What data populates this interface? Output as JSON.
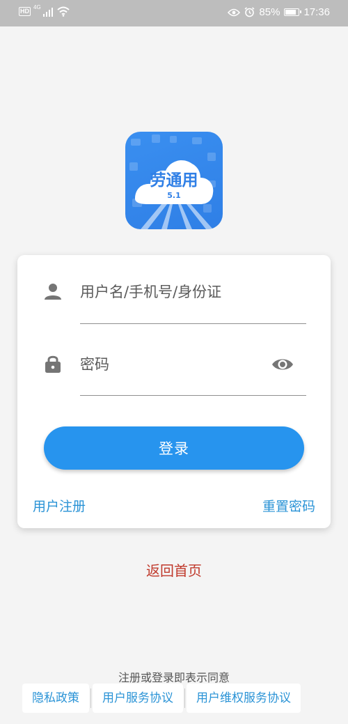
{
  "status_bar": {
    "hd": "HD",
    "network": "4G",
    "battery_percent": "85%",
    "battery_level": 0.85,
    "time": "17:36",
    "icons": [
      "signal-icon",
      "wifi-icon",
      "eye-comfort-icon",
      "alarm-icon",
      "battery-icon"
    ]
  },
  "logo": {
    "name": "劳通用",
    "version": "5.1"
  },
  "login": {
    "username_placeholder": "用户名/手机号/身份证",
    "password_placeholder": "密码",
    "login_label": "登录",
    "register_label": "用户注册",
    "reset_label": "重置密码"
  },
  "back_home_label": "返回首页",
  "agreement": {
    "text": "注册或登录即表示同意",
    "links": [
      "隐私政策",
      "用户服务协议",
      "用户维权服务协议"
    ]
  },
  "colors": {
    "primary": "#2794ee",
    "link": "#2a93d6",
    "back_home": "#c0392b",
    "status_bar": "#bdbdbd",
    "icon": "#757575"
  }
}
